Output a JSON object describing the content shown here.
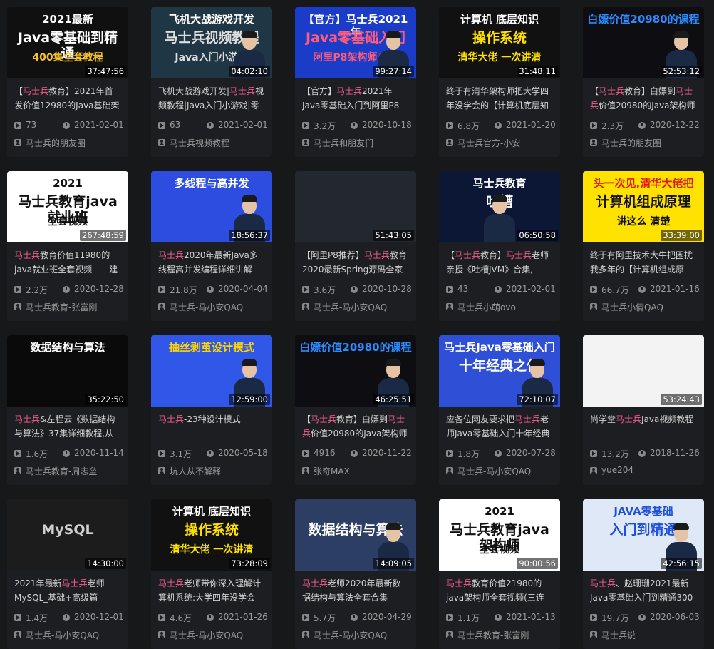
{
  "videos": [
    {
      "duration": "37:47:56",
      "title_hl": "马士兵",
      "title": "【马士兵教育】2021年首发价值12980的Java基础架构",
      "views": "73",
      "date": "2021-02-01",
      "author": "马士兵的朋友圈",
      "thumb": {
        "t1": "2021最新",
        "t2": "Java零基础到精通",
        "t3": "400集全套教程",
        "bg": "#101010",
        "c1": "#ffffff",
        "c2": "#ffffff",
        "c3": "#f6c32c"
      }
    },
    {
      "duration": "04:02:10",
      "title": "飞机大战游戏开发|马士兵视频教程|Java入门小游戏|零",
      "views": "63",
      "date": "2021-02-01",
      "author": "马士兵视频教程",
      "thumb": {
        "t1": "飞机大战游戏开发",
        "t2": "马士兵视频教程",
        "t3": "Java入门小游戏",
        "bg": "#1f3644",
        "c1": "#ffffff",
        "c2": "#dddddd",
        "c3": "#dddddd"
      }
    },
    {
      "duration": "99:27:14",
      "title": "【官方】马士兵2021年Java零基础入门到阿里P8",
      "views": "3.2万",
      "date": "2020-10-18",
      "author": "马士兵和朋友们",
      "thumb": {
        "t1": "【官方】马士兵2021年",
        "t2": "Java零基础入门",
        "t3": "阿里P8架构师400",
        "bg": "#1a3cc9",
        "c1": "#ffffff",
        "c2": "#ff5b7a",
        "c3": "#ff5b7a"
      }
    },
    {
      "duration": "31:48:11",
      "title": "终于有清华架构师把大学四年没学会的【计算机底层知",
      "views": "6.8万",
      "date": "2021-01-20",
      "author": "马士兵官方-小安",
      "thumb": {
        "t1": "计算机 底层知识",
        "t2": "操作系统",
        "t3": "清华大佬 一次讲清",
        "bg": "#111111",
        "c1": "#ffffff",
        "c2": "#ffe100",
        "c3": "#ffe100"
      }
    },
    {
      "duration": "52:53:12",
      "title": "【马士兵教育】白嫖到马士兵价值20980的Java架构师",
      "views": "2.3万",
      "date": "2020-12-22",
      "author": "马士兵的朋友圈",
      "thumb": {
        "t1": "白嫖价值20980的课程",
        "t2": "",
        "t3": "",
        "bg": "#0e0e12",
        "c1": "#2e8bff",
        "c2": "#ffffff",
        "c3": "#ffffff"
      }
    },
    {
      "duration": "267:48:59",
      "title": "马士兵教育价值11980的java就业班全套视频——建",
      "views": "2.2万",
      "date": "2020-12-28",
      "author": "马士兵教育-张富刚",
      "thumb": {
        "t1": "2021",
        "t2": "马士兵教育java就业班",
        "t3": "全套视频",
        "bg": "#ffffff",
        "c1": "#111111",
        "c2": "#111111",
        "c3": "#111111"
      }
    },
    {
      "duration": "18:56:37",
      "title": "马士兵2020年最新Java多线程高并发编程详细讲解",
      "views": "21.8万",
      "date": "2020-04-04",
      "author": "马士兵-马小安QAQ",
      "thumb": {
        "t1": "多线程与高并发",
        "t2": "",
        "t3": "",
        "bg": "#2d4ce0",
        "c1": "#ffffff",
        "c2": "#ffffff",
        "c3": "#ffffff"
      }
    },
    {
      "duration": "51:43:05",
      "title": "【阿里P8推荐】马士兵教育2020最新Spring源码全家桶",
      "views": "3.6万",
      "date": "2020-10-28",
      "author": "马士兵-马小安QAQ",
      "thumb": {
        "t1": "",
        "t2": "",
        "t3": "",
        "bg": "#23272e",
        "c1": "#ffffff",
        "c2": "#ffffff",
        "c3": "#ffffff"
      }
    },
    {
      "duration": "06:50:58",
      "title": "【马士兵教育】马士兵老师亲授《吐槽JVM》合集,",
      "views": "43",
      "date": "2021-02-01",
      "author": "马士兵小萌ovo",
      "thumb": {
        "t1": "马士兵教育",
        "t2": "吐槽",
        "t3": "JVM",
        "bg": "#0c1736",
        "c1": "#ffffff",
        "c2": "#ffffff",
        "c3": "#ffffff"
      }
    },
    {
      "duration": "33:39:00",
      "title": "终于有阿里技术大牛把困扰我多年的【计算机组成原",
      "views": "66.7万",
      "date": "2021-01-16",
      "author": "马士兵小倩QAQ",
      "thumb": {
        "t1": "头一次见,清华大佬把",
        "t2": "计算机组成原理",
        "t3": "讲这么 清楚",
        "bg": "#ffe200",
        "c1": "#e01818",
        "c2": "#111111",
        "c3": "#111111"
      }
    },
    {
      "duration": "35:22:50",
      "title_hl": "马士兵",
      "title": "马士兵&左程云《数据结构与算法》37集详细教程,从",
      "views": "1.6万",
      "date": "2020-11-14",
      "author": "马士兵教育-周志垒",
      "thumb": {
        "t1": "数据结构与算法",
        "t2": "",
        "t3": "",
        "bg": "#0a0a0a",
        "c1": "#ffffff",
        "c2": "#ffffff",
        "c3": "#ffffff"
      }
    },
    {
      "duration": "12:59:00",
      "title": "马士兵-23种设计模式",
      "views": "3.1万",
      "date": "2020-05-18",
      "author": "坑人从不解释",
      "thumb": {
        "t1": "抽丝剥茧设计模式",
        "t2": "",
        "t3": "",
        "bg": "#3057e8",
        "c1": "#ffd700",
        "c2": "#ffffff",
        "c3": "#ffffff"
      }
    },
    {
      "duration": "46:25:51",
      "title": "【马士兵教育】白嫖到马士兵价值20980的Java架构师",
      "views": "4916",
      "date": "2020-11-22",
      "author": "张奇MAX",
      "thumb": {
        "t1": "白嫖价值20980的课程",
        "t2": "",
        "t3": "",
        "bg": "#0e0e12",
        "c1": "#2e8bff",
        "c2": "#ffffff",
        "c3": "#ffffff"
      }
    },
    {
      "duration": "72:10:07",
      "title": "应各位网友要求把马士兵老师Java零基础入门十年经典",
      "views": "1.8万",
      "date": "2020-07-28",
      "author": "马士兵-马小安QAQ",
      "thumb": {
        "t1": "马士兵Java零基础入门",
        "t2": "十年经典之作",
        "t3": "",
        "bg": "#2f4fd6",
        "c1": "#ffffff",
        "c2": "#ffffff",
        "c3": "#ffffff"
      }
    },
    {
      "duration": "53:24:43",
      "title": "尚学堂马士兵Java视频教程",
      "views": "13.2万",
      "date": "2018-11-26",
      "author": "yue204",
      "thumb": {
        "t1": "",
        "t2": "",
        "t3": "",
        "bg": "#f3f3f3",
        "c1": "#333333",
        "c2": "#333333",
        "c3": "#333333"
      }
    },
    {
      "duration": "14:30:00",
      "title": "2021年最新马士兵老师MySQL_基础+高级篇-",
      "views": "1.4万",
      "date": "2020-12-01",
      "author": "马士兵-马小安QAQ",
      "thumb": {
        "t1": "",
        "t2": "MySQL",
        "t3": "",
        "bg": "#1c1c1c",
        "c1": "#ffffff",
        "c2": "#cfcfcf",
        "c3": "#ffffff"
      }
    },
    {
      "duration": "73:28:09",
      "title": "马士兵老师带你深入理解计算机系统:大学四年没学会",
      "views": "4.6万",
      "date": "2021-01-26",
      "author": "马士兵-马小安QAQ",
      "thumb": {
        "t1": "计算机 底层知识",
        "t2": "操作系统",
        "t3": "清华大佬 一次讲清",
        "bg": "#111111",
        "c1": "#ffffff",
        "c2": "#ffe100",
        "c3": "#ffe100"
      }
    },
    {
      "duration": "14:09:05",
      "title": "马士兵老师2020年最新数据结构与算法全套合集",
      "views": "5.7万",
      "date": "2020-04-29",
      "author": "马士兵-马小安QAQ",
      "thumb": {
        "t1": "",
        "t2": "数据结构与算法",
        "t3": "",
        "bg": "#2c3e63",
        "c1": "#ffffff",
        "c2": "#ffffff",
        "c3": "#ffffff"
      }
    },
    {
      "duration": "90:00:56",
      "title": "马士兵教育价值21980的java架构师全套视频(三连",
      "views": "1.1万",
      "date": "2021-01-13",
      "author": "马士兵教育-张富刚",
      "thumb": {
        "t1": "2021",
        "t2": "马士兵教育java架构师",
        "t3": "全套视频",
        "bg": "#ffffff",
        "c1": "#111111",
        "c2": "#111111",
        "c3": "#111111"
      }
    },
    {
      "duration": "42:56:15",
      "title": "马士兵、赵珊珊2021最新Java零基础入门到精通300",
      "views": "19.7万",
      "date": "2020-06-03",
      "author": "马士兵说",
      "thumb": {
        "t1": "JAVA零基础",
        "t2": "入门到精通",
        "t3": "",
        "bg": "#dfe8f7",
        "c1": "#1d4fd8",
        "c2": "#1d4fd8",
        "c3": "#1d4fd8"
      }
    }
  ],
  "highlight_color": "#f25d8e"
}
